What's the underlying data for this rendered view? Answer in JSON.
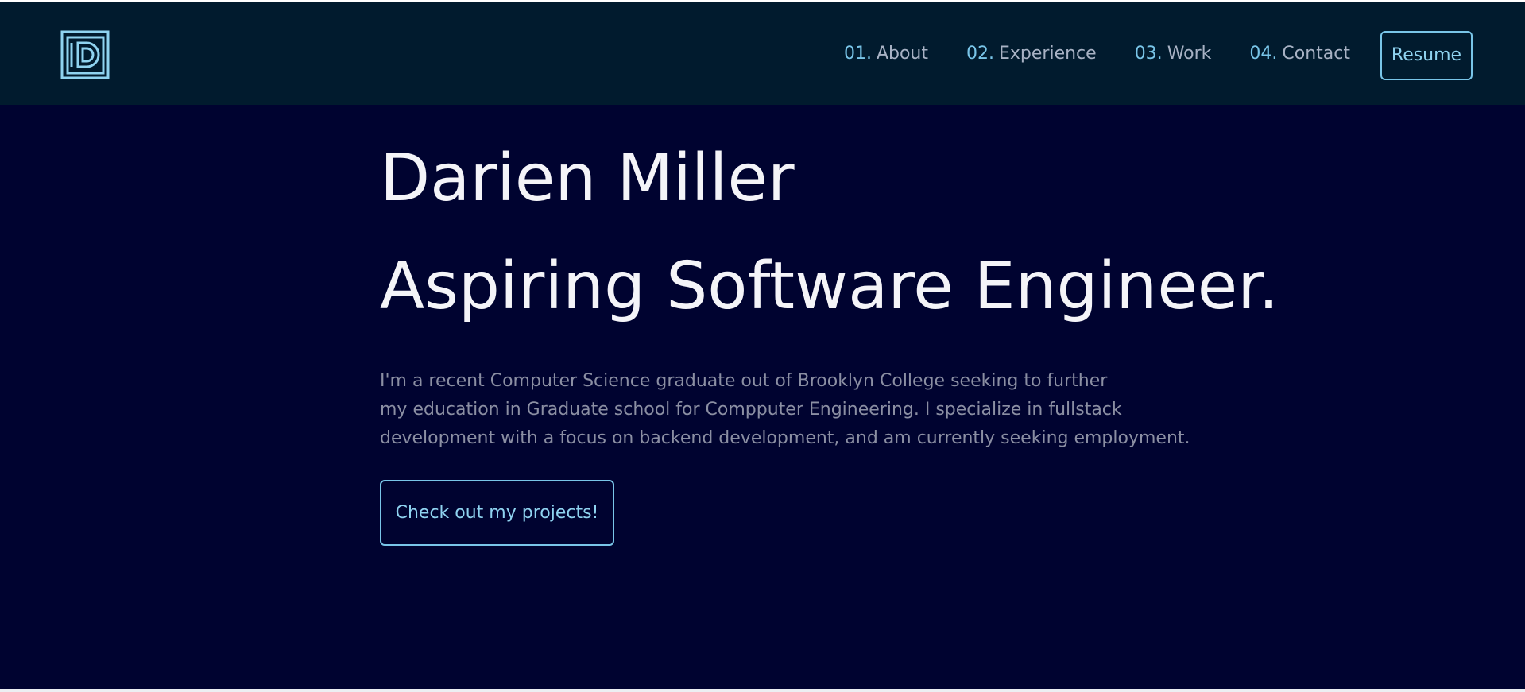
{
  "nav": {
    "logo": "D",
    "links": [
      {
        "num": "01.",
        "label": "About"
      },
      {
        "num": "02.",
        "label": "Experience"
      },
      {
        "num": "03.",
        "label": "Work"
      },
      {
        "num": "04.",
        "label": "Contact"
      }
    ],
    "resume_label": "Resume"
  },
  "hero": {
    "name": "Darien Miller",
    "tagline": "Aspiring Software Engineer.",
    "bio_lines": [
      "I'm a recent Computer Science graduate out of Brooklyn College seeking to further",
      "my education in Graduate school for Compputer Engineering. I specialize in fullstack",
      "development with a focus on backend development, and am currently seeking employment."
    ],
    "cta_label": "Check out my projects!"
  },
  "colors": {
    "nav_bg": "#011b2e",
    "hero_bg": "#000330",
    "accent": "#79c5e8",
    "heading": "#f4f4f8",
    "muted_text": "#8b8fa3"
  }
}
